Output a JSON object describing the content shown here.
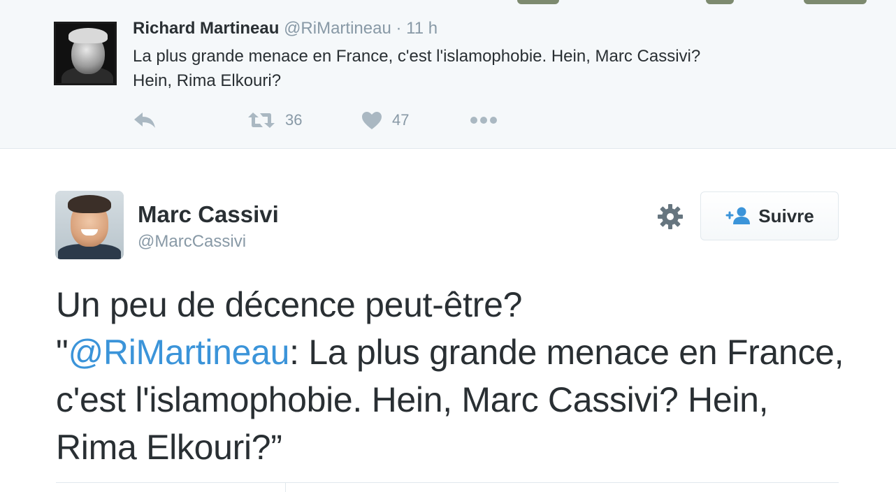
{
  "context_tweet": {
    "name": "Richard Martineau",
    "handle": "@RiMartineau",
    "separator": "·",
    "time": "11 h",
    "text_line1": "La plus grande menace en France, c'est l'islamophobie. Hein, Marc Cassivi?",
    "text_line2": "Hein, Rima Elkouri?",
    "retweet_count": "36",
    "like_count": "47",
    "icons": [
      "reply-icon",
      "retweet-icon",
      "heart-icon",
      "more-icon"
    ]
  },
  "main_tweet": {
    "name": "Marc Cassivi",
    "handle": "@MarcCassivi",
    "follow_label": "Suivre",
    "text_intro": "Un peu de décence peut-être?",
    "quote_open": "\"",
    "mention": "@RiMartineau",
    "text_rest": ": La plus grande menace en France, c'est l'islamophobie. Hein, Marc Cassivi? Hein, Rima Elkouri?”",
    "icons": [
      "gear-icon",
      "follow-user-icon"
    ]
  },
  "colors": {
    "text": "#292f33",
    "muted": "#8899a6",
    "link": "#3b94d9",
    "context_bg": "#f5f8fa",
    "border": "#e1e8ed"
  }
}
